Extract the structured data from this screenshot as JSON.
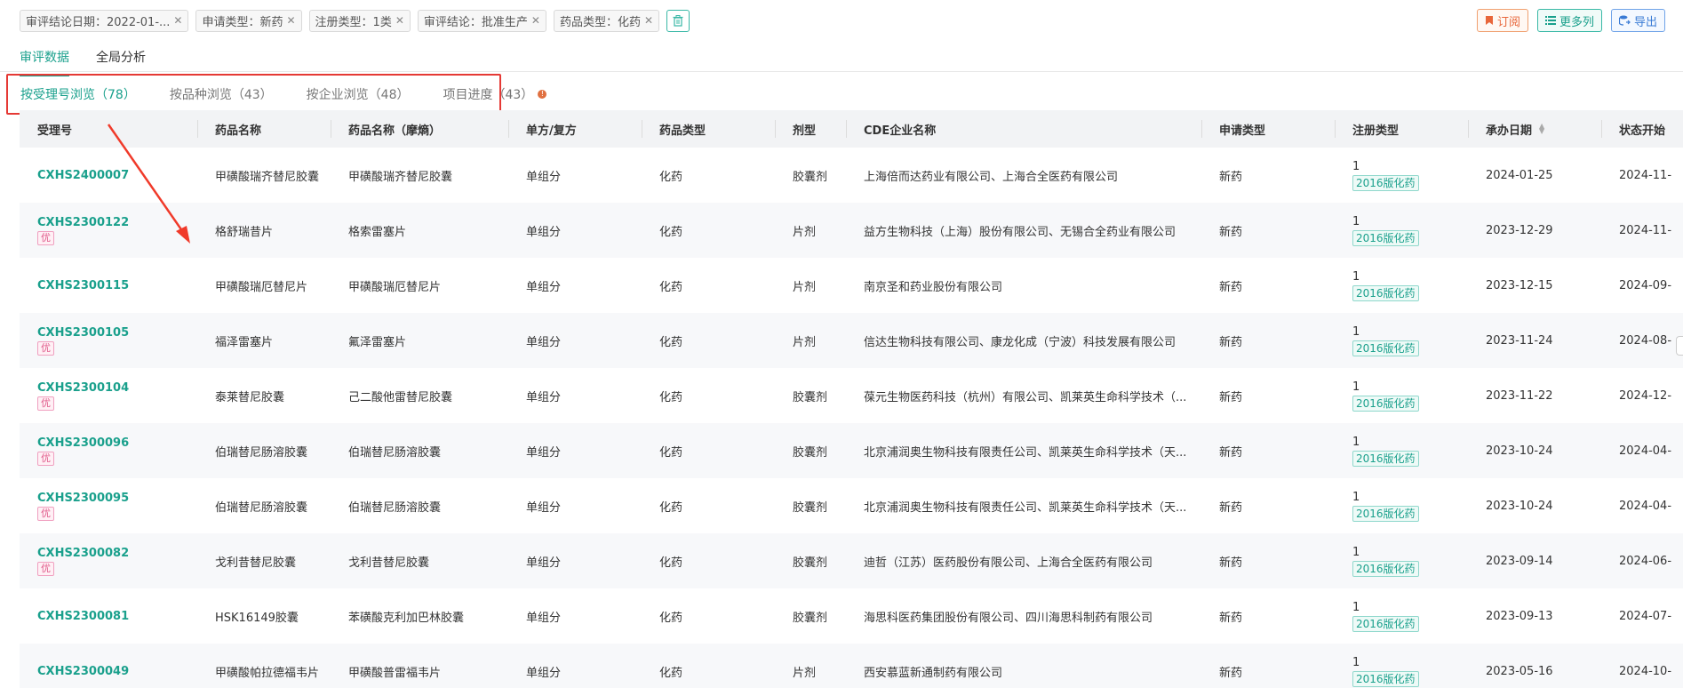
{
  "filters": [
    {
      "label": "审评结论日期：2022-01-..."
    },
    {
      "label": "申请类型：新药"
    },
    {
      "label": "注册类型：1类"
    },
    {
      "label": "审评结论：批准生产"
    },
    {
      "label": "药品类型：化药"
    }
  ],
  "actions": {
    "subscribe": "订阅",
    "more_columns": "更多列",
    "export": "导出"
  },
  "main_tabs": [
    "审评数据",
    "全局分析"
  ],
  "sub_tabs": [
    {
      "label": "按受理号浏览（78）"
    },
    {
      "label": "按品种浏览（43）"
    },
    {
      "label": "按企业浏览（48）"
    },
    {
      "label": "项目进度（43）"
    }
  ],
  "columns": [
    "受理号",
    "药品名称",
    "药品名称（摩熵）",
    "单方/复方",
    "药品类型",
    "剂型",
    "CDE企业名称",
    "申请类型",
    "注册类型",
    "承办日期",
    "状态开始"
  ],
  "rows": [
    {
      "id": "CXHS2400007",
      "you": "",
      "name": "甲磺酸瑞齐替尼胶囊",
      "name2": "甲磺酸瑞齐替尼胶囊",
      "combo": "单组分",
      "dtype": "化药",
      "form": "胶囊剂",
      "company": "上海倍而达药业有限公司、上海合全医药有限公司",
      "app": "新药",
      "reg": "1",
      "reg_tag": "2016版化药",
      "date": "2024-01-25",
      "start": "2024-11-"
    },
    {
      "id": "CXHS2300122",
      "you": "优",
      "name": "格舒瑞昔片",
      "name2": "格索雷塞片",
      "combo": "单组分",
      "dtype": "化药",
      "form": "片剂",
      "company": "益方生物科技（上海）股份有限公司、无锡合全药业有限公司",
      "app": "新药",
      "reg": "1",
      "reg_tag": "2016版化药",
      "date": "2023-12-29",
      "start": "2024-11-"
    },
    {
      "id": "CXHS2300115",
      "you": "",
      "name": "甲磺酸瑞厄替尼片",
      "name2": "甲磺酸瑞厄替尼片",
      "combo": "单组分",
      "dtype": "化药",
      "form": "片剂",
      "company": "南京圣和药业股份有限公司",
      "app": "新药",
      "reg": "1",
      "reg_tag": "2016版化药",
      "date": "2023-12-15",
      "start": "2024-09-"
    },
    {
      "id": "CXHS2300105",
      "you": "优",
      "name": "福泽雷塞片",
      "name2": "氟泽雷塞片",
      "combo": "单组分",
      "dtype": "化药",
      "form": "片剂",
      "company": "信达生物科技有限公司、康龙化成（宁波）科技发展有限公司",
      "app": "新药",
      "reg": "1",
      "reg_tag": "2016版化药",
      "date": "2023-11-24",
      "start": "2024-08-"
    },
    {
      "id": "CXHS2300104",
      "you": "优",
      "name": "泰莱替尼胶囊",
      "name2": "己二酸他雷替尼胶囊",
      "combo": "单组分",
      "dtype": "化药",
      "form": "胶囊剂",
      "company": "葆元生物医药科技（杭州）有限公司、凯莱英生命科学技术（...",
      "app": "新药",
      "reg": "1",
      "reg_tag": "2016版化药",
      "date": "2023-11-22",
      "start": "2024-12-"
    },
    {
      "id": "CXHS2300096",
      "you": "优",
      "name": "伯瑞替尼肠溶胶囊",
      "name2": "伯瑞替尼肠溶胶囊",
      "combo": "单组分",
      "dtype": "化药",
      "form": "胶囊剂",
      "company": "北京浦润奥生物科技有限责任公司、凯莱英生命科学技术（天...",
      "app": "新药",
      "reg": "1",
      "reg_tag": "2016版化药",
      "date": "2023-10-24",
      "start": "2024-04-"
    },
    {
      "id": "CXHS2300095",
      "you": "优",
      "name": "伯瑞替尼肠溶胶囊",
      "name2": "伯瑞替尼肠溶胶囊",
      "combo": "单组分",
      "dtype": "化药",
      "form": "胶囊剂",
      "company": "北京浦润奥生物科技有限责任公司、凯莱英生命科学技术（天...",
      "app": "新药",
      "reg": "1",
      "reg_tag": "2016版化药",
      "date": "2023-10-24",
      "start": "2024-04-"
    },
    {
      "id": "CXHS2300082",
      "you": "优",
      "name": "戈利昔替尼胶囊",
      "name2": "戈利昔替尼胶囊",
      "combo": "单组分",
      "dtype": "化药",
      "form": "胶囊剂",
      "company": "迪哲（江苏）医药股份有限公司、上海合全医药有限公司",
      "app": "新药",
      "reg": "1",
      "reg_tag": "2016版化药",
      "date": "2023-09-14",
      "start": "2024-06-"
    },
    {
      "id": "CXHS2300081",
      "you": "",
      "name": "HSK16149胶囊",
      "name2": "苯磺酸克利加巴林胶囊",
      "combo": "单组分",
      "dtype": "化药",
      "form": "胶囊剂",
      "company": "海思科医药集团股份有限公司、四川海思科制药有限公司",
      "app": "新药",
      "reg": "1",
      "reg_tag": "2016版化药",
      "date": "2023-09-13",
      "start": "2024-07-"
    },
    {
      "id": "CXHS2300049",
      "you": "",
      "name": "甲磺酸帕拉德福韦片",
      "name2": "甲磺酸普雷福韦片",
      "combo": "单组分",
      "dtype": "化药",
      "form": "片剂",
      "company": "西安慕蓝新通制药有限公司",
      "app": "新药",
      "reg": "1",
      "reg_tag": "2016版化药",
      "date": "2023-05-16",
      "start": "2024-10-"
    }
  ]
}
